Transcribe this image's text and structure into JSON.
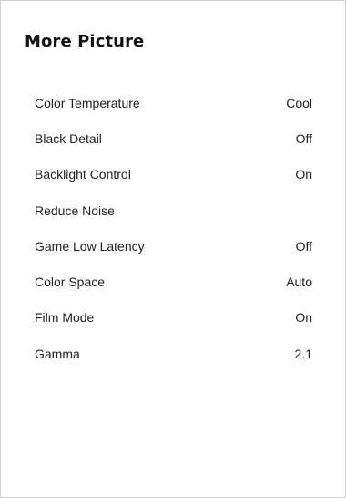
{
  "title": "More Picture",
  "menu": [
    {
      "label": "Color Temperature",
      "value": "Cool"
    },
    {
      "label": "Black Detail",
      "value": "Off"
    },
    {
      "label": "Backlight Control",
      "value": "On"
    },
    {
      "label": "Reduce Noise",
      "value": ""
    },
    {
      "label": "Game Low Latency",
      "value": "Off"
    },
    {
      "label": "Color Space",
      "value": "Auto"
    },
    {
      "label": "Film Mode",
      "value": "On"
    },
    {
      "label": "Gamma",
      "value": "2.1"
    }
  ]
}
